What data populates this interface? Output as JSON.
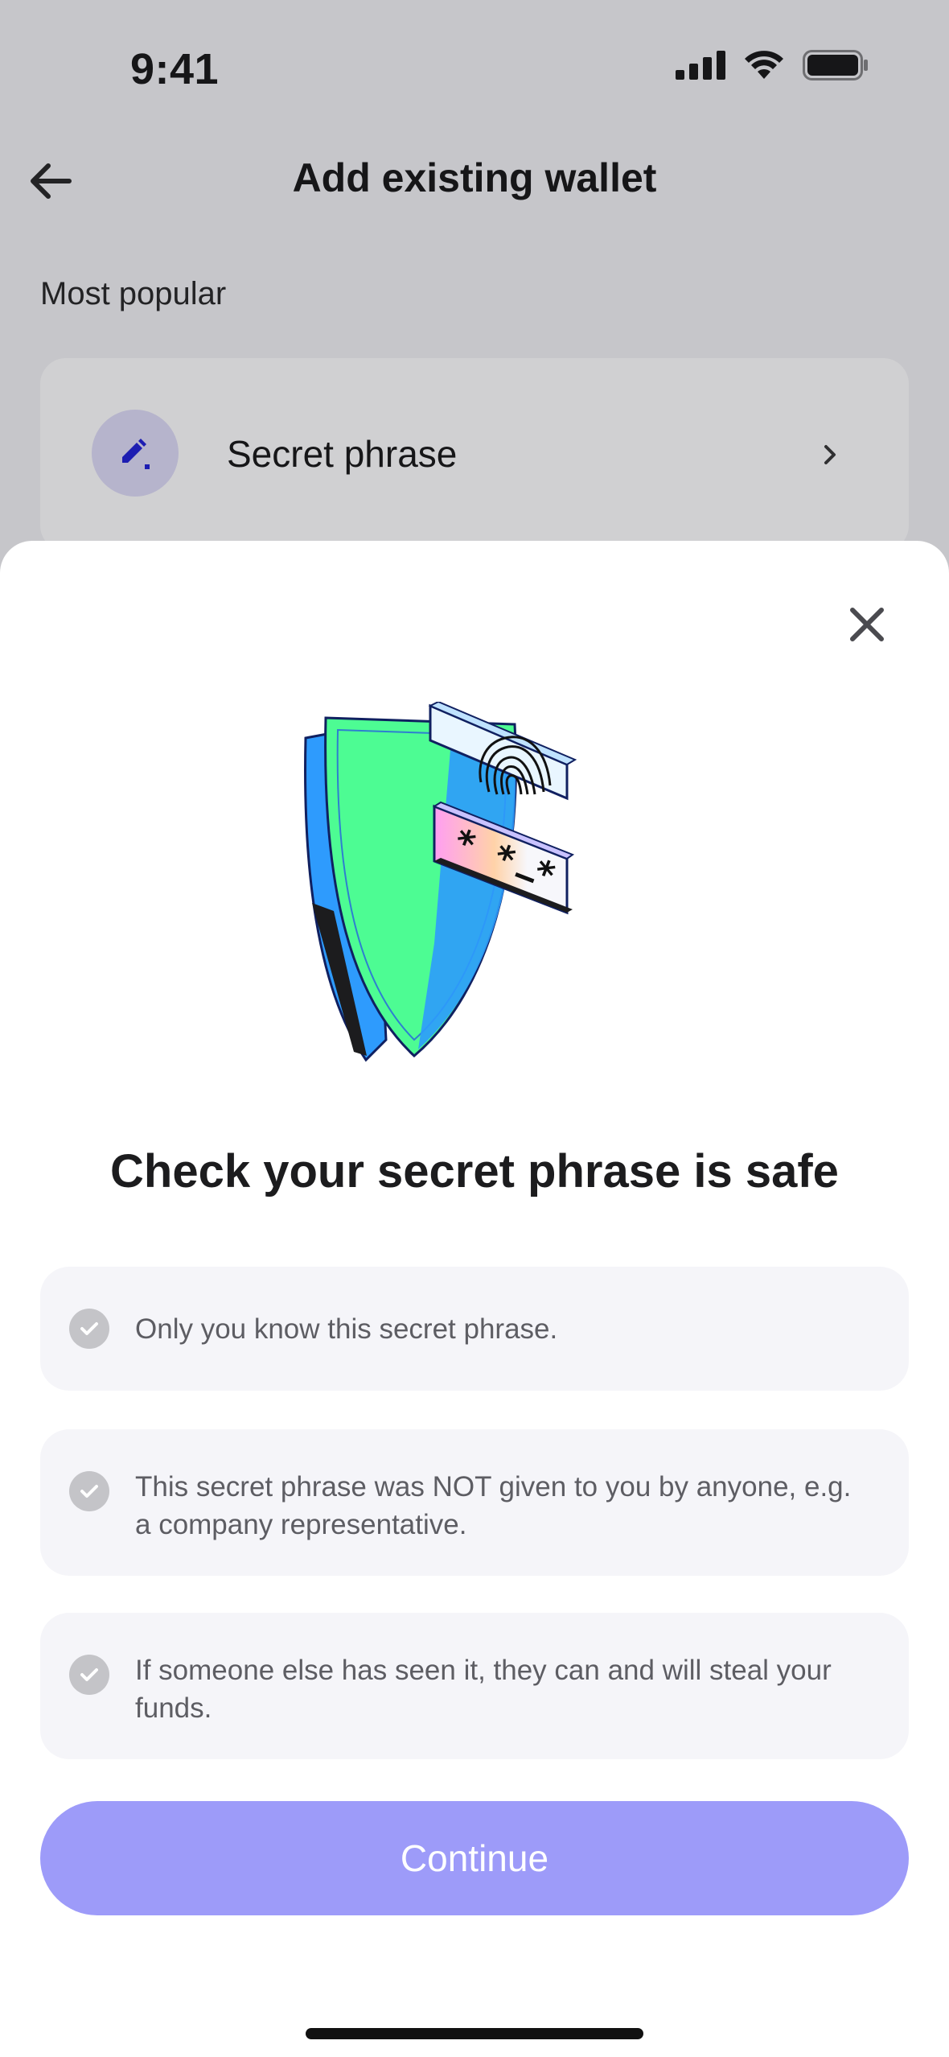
{
  "status_bar": {
    "time": "9:41"
  },
  "header": {
    "title": "Add existing wallet"
  },
  "background": {
    "section_label": "Most popular",
    "option_label": "Secret phrase"
  },
  "sheet": {
    "title": "Check your secret phrase is safe",
    "checklist": [
      "Only you know this secret phrase.",
      "This secret phrase was NOT given to you by anyone, e.g. a company representative.",
      "If someone else has seen it, they can and will steal your funds."
    ],
    "continue_label": "Continue",
    "illustration_text": "* * *"
  },
  "colors": {
    "accent": "#9d9bf9",
    "icon_accent": "#1a1ad6",
    "shield_green": "#4dfc93",
    "shield_blue": "#2e9bfd"
  }
}
